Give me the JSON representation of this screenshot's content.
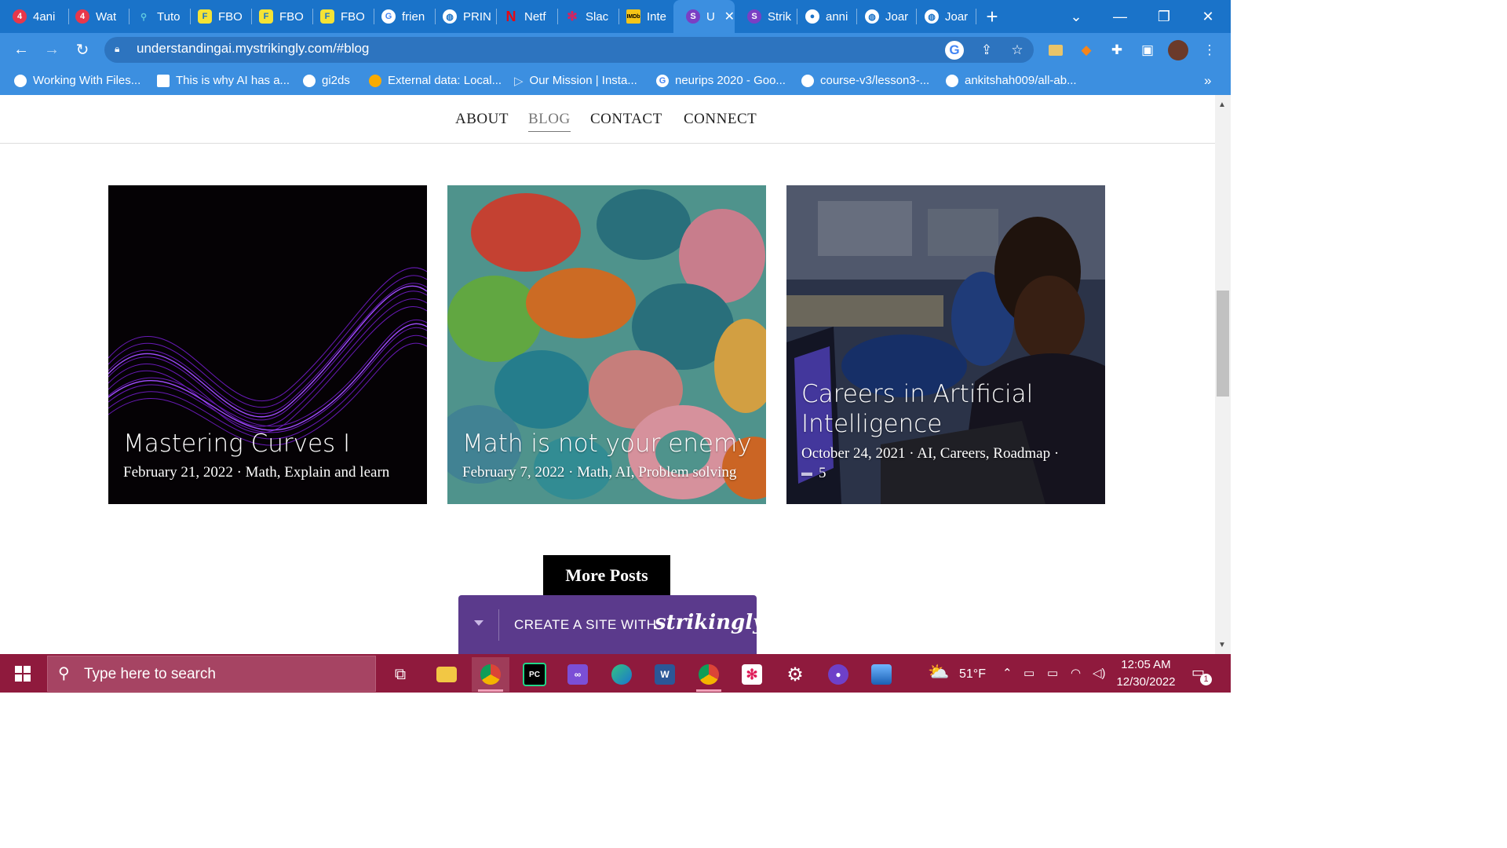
{
  "browser": {
    "tabs": [
      {
        "label": "4ani",
        "favicon": "number-4-icon",
        "color": "#e8374b"
      },
      {
        "label": "Wat",
        "favicon": "number-4-icon",
        "color": "#e8374b"
      },
      {
        "label": "Tuto",
        "favicon": "graph-icon",
        "color": "#5ec8e0"
      },
      {
        "label": "FBO",
        "favicon": "fbo-icon",
        "color": "#f5e335"
      },
      {
        "label": "FBO",
        "favicon": "fbo-icon",
        "color": "#f5e335"
      },
      {
        "label": "FBO",
        "favicon": "fbo-icon",
        "color": "#f5e335"
      },
      {
        "label": "frien",
        "favicon": "google-icon",
        "color": "#ffffff"
      },
      {
        "label": "PRIN",
        "favicon": "globe-icon",
        "color": "#ffffff"
      },
      {
        "label": "Netf",
        "favicon": "netflix-icon",
        "color": "#e50914"
      },
      {
        "label": "Slac",
        "favicon": "slack-icon",
        "color": "#e01e5a"
      },
      {
        "label": "Inte",
        "favicon": "imdb-icon",
        "color": "#f5c518"
      },
      {
        "label": "U",
        "favicon": "strikingly-icon",
        "color": "#7a3fc4",
        "active": true
      },
      {
        "label": "Strik",
        "favicon": "strikingly-icon",
        "color": "#7a3fc4"
      },
      {
        "label": "anni",
        "favicon": "github-icon",
        "color": "#ffffff"
      },
      {
        "label": "Joar",
        "favicon": "globe-icon",
        "color": "#ffffff"
      },
      {
        "label": "Joar",
        "favicon": "globe-icon",
        "color": "#ffffff"
      }
    ],
    "url": "understandingai.mystrikingly.com/#blog",
    "bookmarks": [
      {
        "label": "Working With Files..."
      },
      {
        "label": "This is why AI has a..."
      },
      {
        "label": "gi2ds"
      },
      {
        "label": "External data: Local..."
      },
      {
        "label": "Our Mission | Insta..."
      },
      {
        "label": "neurips 2020 - Goo..."
      },
      {
        "label": "course-v3/lesson3-..."
      },
      {
        "label": "ankitshah009/all-ab..."
      }
    ],
    "bookmarks_overflow": "»"
  },
  "site": {
    "nav": {
      "about": "ABOUT",
      "blog": "BLOG",
      "contact": "CONTACT",
      "connect": "CONNECT"
    },
    "posts": [
      {
        "title": "Mastering Curves I",
        "meta": "February 21, 2022 · Math, Explain and learn"
      },
      {
        "title": "Math is not your enemy",
        "meta": "February 7, 2022 · Math, AI, Problem solving"
      },
      {
        "title_line1": "Careers in Artificial",
        "title_line2": "Intelligence",
        "meta": "October 24, 2021 · AI, Careers, Roadmap ·",
        "comments": "5"
      }
    ],
    "more_posts": "More Posts",
    "strikingly": {
      "label": "CREATE A SITE WITH",
      "brand": "strikingly"
    }
  },
  "taskbar": {
    "search_placeholder": "Type here to search",
    "weather": "51°F",
    "time": "12:05 AM",
    "date": "12/30/2022",
    "notifications": "1"
  },
  "colors": {
    "tabstrip": "#1a73c9",
    "toolbar": "#3c8fe0",
    "taskbar": "#8f1a3d",
    "strikingly": "#5b3a8c"
  }
}
